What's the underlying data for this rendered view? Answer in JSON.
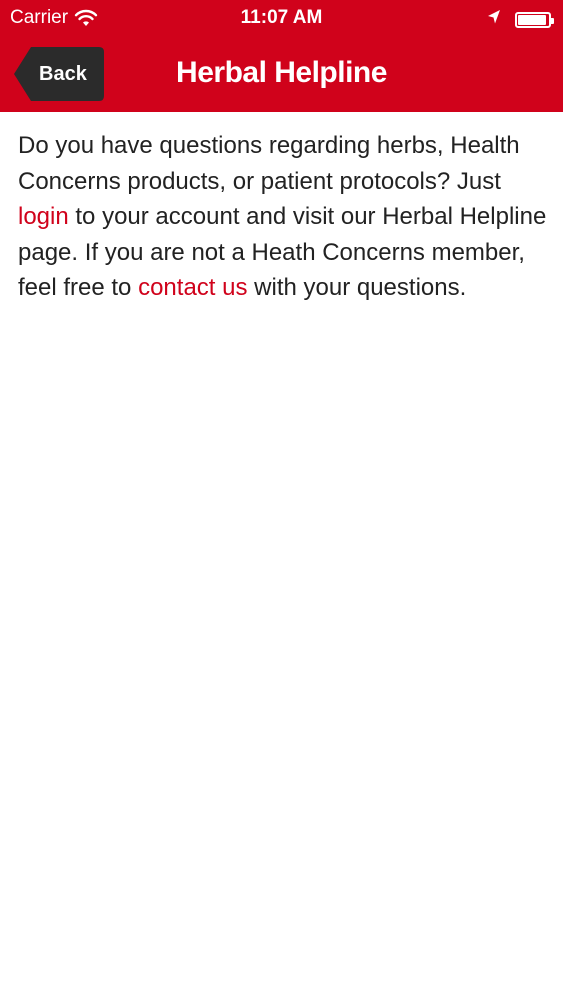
{
  "status_bar": {
    "carrier": "Carrier",
    "time": "11:07 AM",
    "battery_level": 0.95
  },
  "nav": {
    "back_label": "Back",
    "title": "Herbal Helpline"
  },
  "content": {
    "text_1": "Do you have questions regarding herbs, Health Concerns products, or patient protocols? Just ",
    "login_link": "login",
    "text_2": " to your account and visit our Herbal Helpline page. If you are not a Heath Concerns member, feel free to ",
    "contact_link": "contact us",
    "text_3": " with your questions."
  },
  "colors": {
    "brand_red": "#d0021b",
    "back_button": "#2b2b2b",
    "text": "#222222",
    "background": "#ffffff"
  },
  "icons": {
    "wifi": "wifi-icon",
    "location": "location-arrow-icon",
    "battery": "battery-icon",
    "back": "back-arrow-icon"
  }
}
